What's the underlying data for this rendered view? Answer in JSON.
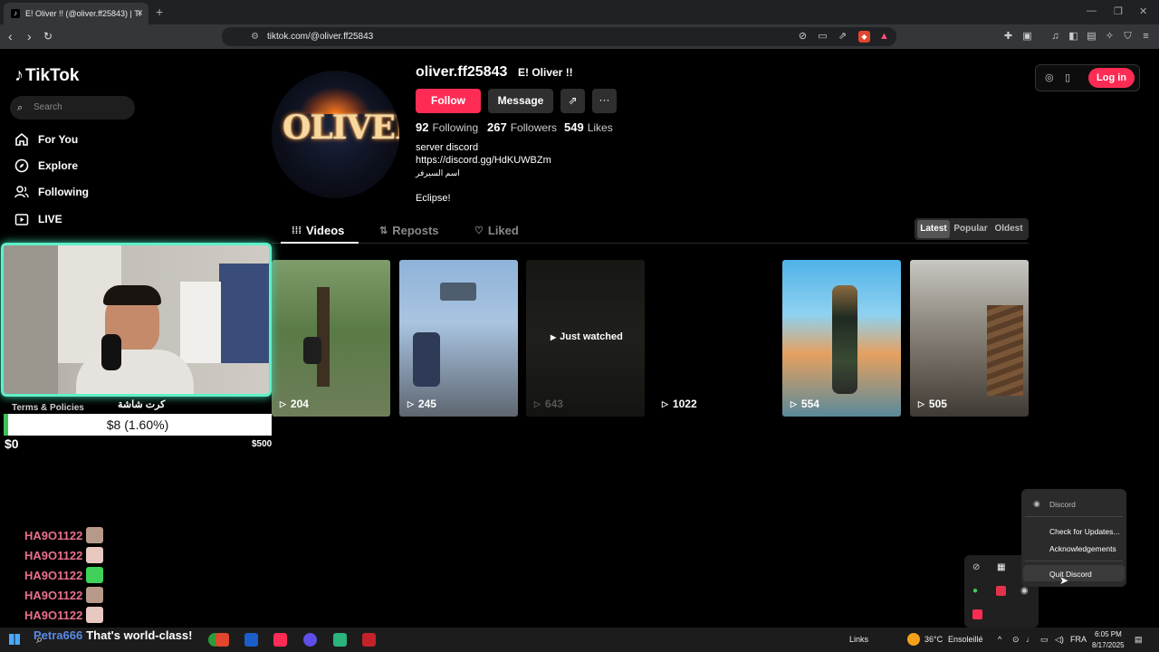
{
  "browser": {
    "tab_title": "E! Oliver !! (@oliver.ff25843) | Ti",
    "url": "tiktok.com/@oliver.ff25843"
  },
  "sidebar": {
    "logo": "TikTok",
    "search_placeholder": "Search",
    "items": [
      {
        "label": "For You",
        "icon": "home-icon"
      },
      {
        "label": "Explore",
        "icon": "compass-icon"
      },
      {
        "label": "Following",
        "icon": "people-icon"
      },
      {
        "label": "LIVE",
        "icon": "live-icon"
      }
    ]
  },
  "profile": {
    "username": "oliver.ff25843",
    "nickname": "E! Oliver !!",
    "avatar_text": "OLIVER",
    "follow_label": "Follow",
    "message_label": "Message",
    "stats": {
      "following_count": "92",
      "following_label": "Following",
      "followers_count": "267",
      "followers_label": "Followers",
      "likes_count": "549",
      "likes_label": "Likes"
    },
    "bio": [
      "server discord",
      "https://discord.gg/HdKUWBZm",
      "اسم السيرفر",
      "Eclipse!"
    ]
  },
  "tabs": {
    "videos": "Videos",
    "reposts": "Reposts",
    "liked": "Liked",
    "sort": [
      "Latest",
      "Popular",
      "Oldest"
    ],
    "sort_selected": "Latest"
  },
  "videos": [
    {
      "views": "204"
    },
    {
      "views": "245"
    },
    {
      "views": "643",
      "overlay": "Just watched"
    },
    {
      "views": "1022"
    },
    {
      "views": "554"
    },
    {
      "views": "505"
    }
  ],
  "header_right": {
    "login_label": "Log in"
  },
  "stream_overlay": {
    "terms": "Terms & Policies",
    "arabic_label": "كرت شاشة",
    "goal_text": "$8 (1.60%)",
    "goal_progress": 0.016,
    "goal_min": "$0",
    "goal_max": "$500",
    "chat_users": [
      "HA9O1122",
      "HA9O1122",
      "HA9O1122",
      "HA9O1122",
      "HA9O1122"
    ],
    "chat_last_user": "Petra666",
    "chat_last_message": "That's world-class!"
  },
  "context_menu": {
    "title": "Discord",
    "items": [
      "Check for Updates...",
      "Acknowledgements",
      "Quit Discord"
    ]
  },
  "taskbar": {
    "links": "Links",
    "weather_temp": "36°C",
    "weather_desc": "Ensoleillé",
    "lang": "FRA",
    "time": "6:05 PM",
    "date": "8/17/2025"
  },
  "colors": {
    "accent": "#fe2c55",
    "cam_border": "#5ff0c8",
    "goal_fill": "#3fc15a",
    "chat_name": "#e9708d"
  }
}
